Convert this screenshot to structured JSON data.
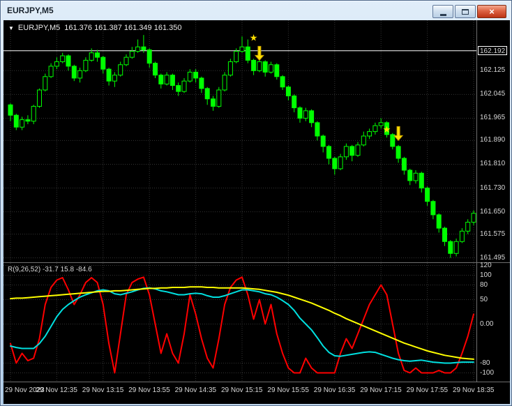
{
  "window": {
    "title": "EURJPY,M5",
    "buttons": {
      "close_glyph": "×"
    }
  },
  "chart_header": {
    "dropdown_glyph": "▼",
    "symbol": "EURJPY,M5",
    "ohlc": "161.376 161.387 161.349 161.350"
  },
  "indicator_header": "R(9,26,52) -31.7 15.8 -84.6",
  "chart_data": {
    "type": "candlestick",
    "symbol": "EURJPY",
    "timeframe": "M5",
    "price_line": 162.192,
    "colors": {
      "bg": "#000000",
      "grid": "#343434",
      "bull_fill": "#000000",
      "bear_fill": "#00FF00",
      "outline": "#00FF00",
      "price_line": "#FFFFFF",
      "marker": "#FFE000",
      "marker_edge": "#C8A000",
      "axis_text": "#D8D8D8"
    },
    "price_axis": [
      {
        "label": "162.192",
        "value": 162.192,
        "line": true
      },
      {
        "label": "162.125",
        "value": 162.125
      },
      {
        "label": "162.045",
        "value": 162.045
      },
      {
        "label": "161.965",
        "value": 161.965
      },
      {
        "label": "161.890",
        "value": 161.89
      },
      {
        "label": "161.810",
        "value": 161.81
      },
      {
        "label": "161.730",
        "value": 161.73
      },
      {
        "label": "161.650",
        "value": 161.65
      },
      {
        "label": "161.575",
        "value": 161.575
      },
      {
        "label": "161.495",
        "value": 161.495
      }
    ],
    "time_axis": [
      {
        "label": "29 Nov 2023",
        "index": 0
      },
      {
        "label": "29 Nov 12:35",
        "index": 8
      },
      {
        "label": "29 Nov 13:15",
        "index": 16
      },
      {
        "label": "29 Nov 13:55",
        "index": 24
      },
      {
        "label": "29 Nov 14:35",
        "index": 32
      },
      {
        "label": "29 Nov 15:15",
        "index": 40
      },
      {
        "label": "29 Nov 15:55",
        "index": 48
      },
      {
        "label": "29 Nov 16:35",
        "index": 56
      },
      {
        "label": "29 Nov 17:15",
        "index": 64
      },
      {
        "label": "29 Nov 17:55",
        "index": 72
      },
      {
        "label": "29 Nov 18:35",
        "index": 80
      }
    ],
    "candles": [
      [
        162.01,
        162.015,
        161.955,
        161.975
      ],
      [
        161.975,
        161.98,
        161.925,
        161.935
      ],
      [
        161.935,
        161.97,
        161.925,
        161.96
      ],
      [
        161.96,
        161.975,
        161.945,
        161.955
      ],
      [
        161.955,
        162.01,
        161.945,
        162.005
      ],
      [
        162.005,
        162.065,
        162.0,
        162.06
      ],
      [
        162.06,
        162.115,
        162.055,
        162.105
      ],
      [
        162.105,
        162.15,
        162.1,
        162.14
      ],
      [
        162.14,
        162.17,
        162.13,
        162.155
      ],
      [
        162.155,
        162.185,
        162.15,
        162.175
      ],
      [
        162.175,
        162.18,
        162.125,
        162.14
      ],
      [
        162.14,
        162.145,
        162.09,
        162.1
      ],
      [
        162.1,
        162.135,
        162.085,
        162.125
      ],
      [
        162.125,
        162.17,
        162.12,
        162.16
      ],
      [
        162.16,
        162.2,
        162.155,
        162.185
      ],
      [
        162.185,
        162.195,
        162.155,
        162.17
      ],
      [
        162.17,
        162.175,
        162.115,
        162.13
      ],
      [
        162.13,
        162.135,
        162.075,
        162.09
      ],
      [
        162.09,
        162.12,
        162.07,
        162.11
      ],
      [
        162.11,
        162.155,
        162.105,
        162.145
      ],
      [
        162.145,
        162.18,
        162.14,
        162.17
      ],
      [
        162.17,
        162.205,
        162.165,
        162.19
      ],
      [
        162.19,
        162.23,
        162.185,
        162.205
      ],
      [
        162.205,
        162.245,
        162.185,
        162.195
      ],
      [
        162.195,
        162.2,
        162.135,
        162.15
      ],
      [
        162.15,
        162.155,
        162.1,
        162.11
      ],
      [
        162.11,
        162.115,
        162.065,
        162.08
      ],
      [
        162.08,
        162.12,
        162.075,
        162.11
      ],
      [
        162.11,
        162.115,
        162.06,
        162.075
      ],
      [
        162.075,
        162.085,
        162.04,
        162.055
      ],
      [
        162.055,
        162.1,
        162.05,
        162.09
      ],
      [
        162.09,
        162.13,
        162.085,
        162.12
      ],
      [
        162.12,
        162.13,
        162.085,
        162.1
      ],
      [
        162.1,
        162.105,
        162.05,
        162.065
      ],
      [
        162.065,
        162.07,
        162.01,
        162.03
      ],
      [
        162.03,
        162.04,
        161.99,
        162.005
      ],
      [
        162.005,
        162.07,
        162.0,
        162.06
      ],
      [
        162.06,
        162.12,
        162.055,
        162.11
      ],
      [
        162.11,
        162.165,
        162.105,
        162.155
      ],
      [
        162.155,
        162.2,
        162.15,
        162.19
      ],
      [
        162.19,
        162.24,
        162.185,
        162.205
      ],
      [
        162.205,
        162.23,
        162.15,
        162.16
      ],
      [
        162.16,
        162.165,
        162.11,
        162.125
      ],
      [
        162.125,
        162.165,
        162.12,
        162.155
      ],
      [
        162.155,
        162.16,
        162.105,
        162.12
      ],
      [
        162.12,
        162.155,
        162.115,
        162.145
      ],
      [
        162.145,
        162.15,
        162.095,
        162.105
      ],
      [
        162.105,
        162.11,
        162.06,
        162.07
      ],
      [
        162.07,
        162.075,
        162.025,
        162.04
      ],
      [
        162.04,
        162.045,
        161.985,
        162.0
      ],
      [
        162.0,
        162.005,
        161.95,
        161.965
      ],
      [
        161.965,
        162.0,
        161.955,
        161.99
      ],
      [
        161.99,
        161.995,
        161.935,
        161.95
      ],
      [
        161.95,
        161.955,
        161.89,
        161.905
      ],
      [
        161.905,
        161.91,
        161.85,
        161.87
      ],
      [
        161.87,
        161.875,
        161.81,
        161.83
      ],
      [
        161.83,
        161.835,
        161.775,
        161.795
      ],
      [
        161.795,
        161.845,
        161.79,
        161.835
      ],
      [
        161.835,
        161.88,
        161.825,
        161.87
      ],
      [
        161.87,
        161.875,
        161.82,
        161.84
      ],
      [
        161.84,
        161.885,
        161.835,
        161.875
      ],
      [
        161.875,
        161.92,
        161.87,
        161.905
      ],
      [
        161.905,
        161.93,
        161.895,
        161.92
      ],
      [
        161.92,
        161.95,
        161.91,
        161.94
      ],
      [
        161.94,
        161.965,
        161.93,
        161.95
      ],
      [
        161.95,
        161.955,
        161.9,
        161.91
      ],
      [
        161.91,
        161.915,
        161.86,
        161.87
      ],
      [
        161.87,
        161.875,
        161.815,
        161.83
      ],
      [
        161.83,
        161.835,
        161.775,
        161.79
      ],
      [
        161.79,
        161.795,
        161.74,
        161.755
      ],
      [
        161.755,
        161.79,
        161.745,
        161.78
      ],
      [
        161.78,
        161.785,
        161.715,
        161.73
      ],
      [
        161.73,
        161.735,
        161.67,
        161.685
      ],
      [
        161.685,
        161.69,
        161.625,
        161.64
      ],
      [
        161.64,
        161.645,
        161.58,
        161.595
      ],
      [
        161.595,
        161.6,
        161.535,
        161.55
      ],
      [
        161.55,
        161.555,
        161.495,
        161.51
      ],
      [
        161.51,
        161.56,
        161.5,
        161.55
      ],
      [
        161.55,
        161.595,
        161.545,
        161.585
      ],
      [
        161.585,
        161.625,
        161.575,
        161.615
      ],
      [
        161.615,
        161.655,
        161.605,
        161.645
      ]
    ],
    "markers": [
      {
        "type": "star",
        "index": 42,
        "price": 162.235
      },
      {
        "type": "arrow",
        "index": 43,
        "price": 162.16
      },
      {
        "type": "star",
        "index": 65,
        "price": 161.926
      },
      {
        "type": "arrow",
        "index": 67,
        "price": 161.89
      }
    ],
    "indicator": {
      "label": "R(9,26,52) -31.7 15.8 -84.6",
      "range": [
        -115,
        125
      ],
      "axis": [
        {
          "label": "120",
          "value": 120
        },
        {
          "label": "100",
          "value": 100
        },
        {
          "label": "80",
          "value": 80
        },
        {
          "label": "50",
          "value": 50
        },
        {
          "label": "0.00",
          "value": 0
        },
        {
          "label": "-80",
          "value": -80
        },
        {
          "label": "-100",
          "value": -100
        }
      ],
      "series": [
        {
          "name": "fast",
          "color": "#FF0000",
          "values": [
            -40,
            -80,
            -60,
            -75,
            -70,
            -30,
            40,
            75,
            90,
            95,
            70,
            40,
            60,
            85,
            95,
            85,
            40,
            -40,
            -100,
            -20,
            60,
            85,
            92,
            96,
            60,
            0,
            -60,
            -20,
            -60,
            -80,
            -20,
            60,
            20,
            -30,
            -70,
            -90,
            -30,
            40,
            75,
            90,
            96,
            60,
            10,
            50,
            0,
            40,
            -20,
            -60,
            -90,
            -100,
            -100,
            -70,
            -90,
            -100,
            -100,
            -100,
            -100,
            -60,
            -30,
            -50,
            -20,
            10,
            40,
            60,
            80,
            60,
            0,
            -60,
            -95,
            -100,
            -90,
            -100,
            -100,
            -100,
            -95,
            -100,
            -100,
            -90,
            -60,
            -25,
            20
          ]
        },
        {
          "name": "medium",
          "color": "#00E0E0",
          "values": [
            -45,
            -48,
            -50,
            -50,
            -50,
            -40,
            -25,
            -5,
            15,
            30,
            40,
            48,
            55,
            60,
            64,
            68,
            70,
            68,
            62,
            60,
            63,
            66,
            70,
            73,
            74,
            72,
            68,
            66,
            63,
            60,
            60,
            62,
            63,
            62,
            58,
            55,
            55,
            58,
            62,
            66,
            70,
            70,
            68,
            66,
            62,
            60,
            55,
            48,
            40,
            28,
            12,
            0,
            -12,
            -28,
            -45,
            -58,
            -65,
            -66,
            -64,
            -62,
            -60,
            -58,
            -57,
            -58,
            -62,
            -66,
            -70,
            -73,
            -75,
            -76,
            -75,
            -74,
            -76,
            -78,
            -79,
            -80,
            -80,
            -79,
            -78,
            -78,
            -78
          ]
        },
        {
          "name": "slow",
          "color": "#FFFF00",
          "values": [
            52,
            53,
            53,
            54,
            55,
            56,
            57,
            58,
            59,
            60,
            61,
            62,
            63,
            64,
            65,
            66,
            67,
            67,
            68,
            68,
            69,
            70,
            71,
            72,
            73,
            73,
            74,
            74,
            75,
            75,
            75,
            76,
            76,
            76,
            75,
            75,
            74,
            74,
            74,
            74,
            74,
            73,
            72,
            71,
            69,
            67,
            65,
            62,
            59,
            55,
            51,
            47,
            43,
            38,
            33,
            28,
            22,
            17,
            11,
            6,
            1,
            -4,
            -9,
            -14,
            -19,
            -24,
            -29,
            -34,
            -39,
            -43,
            -47,
            -51,
            -55,
            -58,
            -61,
            -64,
            -66,
            -68,
            -70,
            -71,
            -72
          ]
        }
      ]
    }
  }
}
